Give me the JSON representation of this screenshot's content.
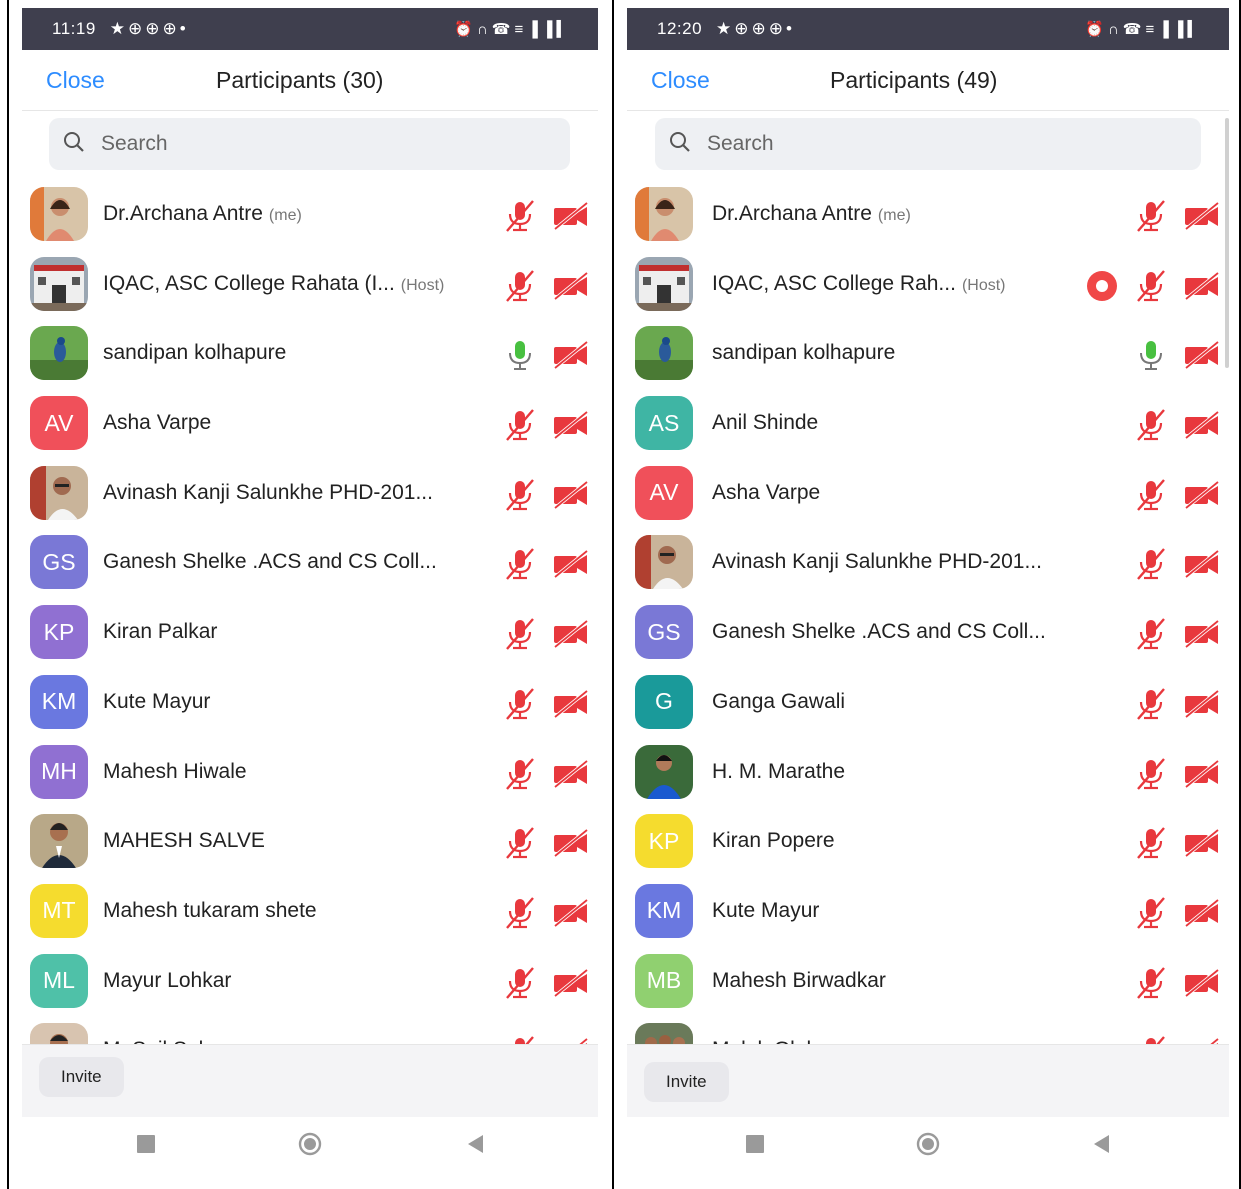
{
  "colors": {
    "accent": "#2d8cff",
    "muted_red": "#e8383d",
    "unmuted_green": "#48c040",
    "status_bar": "#3f3f4e"
  },
  "phones": [
    {
      "status_time": "11:19",
      "close_label": "Close",
      "title": "Participants (30)",
      "search_placeholder": "Search",
      "invite_label": "Invite",
      "participants": [
        {
          "name": "Dr.Archana Antre",
          "tag": "(me)",
          "avatar": "photo-woman",
          "mic": "muted",
          "video": "off"
        },
        {
          "name": "IQAC, ASC College Rahata (I...",
          "tag": "(Host)",
          "avatar": "photo-building",
          "mic": "muted",
          "video": "off"
        },
        {
          "name": "sandipan kolhapure",
          "tag": "",
          "avatar": "photo-peacock",
          "mic": "on",
          "video": "off"
        },
        {
          "name": "Asha Varpe",
          "tag": "",
          "initials": "AV",
          "color": "#f0505a",
          "mic": "muted",
          "video": "off"
        },
        {
          "name": "Avinash Kanji Salunkhe PHD-201...",
          "tag": "",
          "avatar": "photo-man-glasses",
          "mic": "muted",
          "video": "off"
        },
        {
          "name": "Ganesh Shelke .ACS and CS Coll...",
          "tag": "",
          "initials": "GS",
          "color": "#7a78d6",
          "mic": "muted",
          "video": "off"
        },
        {
          "name": "Kiran Palkar",
          "tag": "",
          "initials": "KP",
          "color": "#9070d2",
          "mic": "muted",
          "video": "off"
        },
        {
          "name": "Kute Mayur",
          "tag": "",
          "initials": "KM",
          "color": "#6a78e0",
          "mic": "muted",
          "video": "off"
        },
        {
          "name": "Mahesh Hiwale",
          "tag": "",
          "initials": "MH",
          "color": "#9070d2",
          "mic": "muted",
          "video": "off"
        },
        {
          "name": "MAHESH SALVE",
          "tag": "",
          "avatar": "photo-man-suit",
          "mic": "muted",
          "video": "off"
        },
        {
          "name": "Mahesh tukaram shete",
          "tag": "",
          "initials": "MT",
          "color": "#f5dc2e",
          "mic": "muted",
          "video": "off"
        },
        {
          "name": "Mayur Lohkar",
          "tag": "",
          "initials": "ML",
          "color": "#4fc1a8",
          "mic": "muted",
          "video": "off"
        },
        {
          "name": "M. S. il S. l",
          "tag": "",
          "avatar": "photo-man-partial",
          "mic": "muted",
          "video": "off"
        }
      ]
    },
    {
      "status_time": "12:20",
      "close_label": "Close",
      "title": "Participants (49)",
      "search_placeholder": "Search",
      "invite_label": "Invite",
      "participants": [
        {
          "name": "Dr.Archana Antre",
          "tag": "(me)",
          "avatar": "photo-woman",
          "mic": "muted",
          "video": "off"
        },
        {
          "name": "IQAC, ASC College Rah...",
          "tag": "(Host)",
          "avatar": "photo-building",
          "mic": "muted",
          "video": "off",
          "recording": true
        },
        {
          "name": "sandipan kolhapure",
          "tag": "",
          "avatar": "photo-peacock",
          "mic": "on",
          "video": "off"
        },
        {
          "name": "Anil Shinde",
          "tag": "",
          "initials": "AS",
          "color": "#3fb5a4",
          "mic": "muted",
          "video": "off"
        },
        {
          "name": "Asha Varpe",
          "tag": "",
          "initials": "AV",
          "color": "#f0505a",
          "mic": "muted",
          "video": "off"
        },
        {
          "name": "Avinash Kanji Salunkhe PHD-201...",
          "tag": "",
          "avatar": "photo-man-glasses",
          "mic": "muted",
          "video": "off"
        },
        {
          "name": "Ganesh Shelke .ACS and CS Coll...",
          "tag": "",
          "initials": "GS",
          "color": "#7a78d6",
          "mic": "muted",
          "video": "off"
        },
        {
          "name": "Ganga Gawali",
          "tag": "",
          "initials": "G",
          "color": "#1a9a9a",
          "mic": "muted",
          "video": "off"
        },
        {
          "name": "H. M. Marathe",
          "tag": "",
          "avatar": "photo-man-blue",
          "mic": "muted",
          "video": "off"
        },
        {
          "name": "Kiran Popere",
          "tag": "",
          "initials": "KP",
          "color": "#f5dc2e",
          "mic": "muted",
          "video": "off"
        },
        {
          "name": "Kute Mayur",
          "tag": "",
          "initials": "KM",
          "color": "#6a78e0",
          "mic": "muted",
          "video": "off"
        },
        {
          "name": "Mahesh Birwadkar",
          "tag": "",
          "initials": "MB",
          "color": "#90d070",
          "mic": "muted",
          "video": "off"
        },
        {
          "name": "M. l. l. Gl. l",
          "tag": "",
          "avatar": "photo-group",
          "mic": "muted",
          "video": "off"
        }
      ]
    }
  ],
  "nav": [
    "recents-button",
    "home-button",
    "back-button"
  ]
}
